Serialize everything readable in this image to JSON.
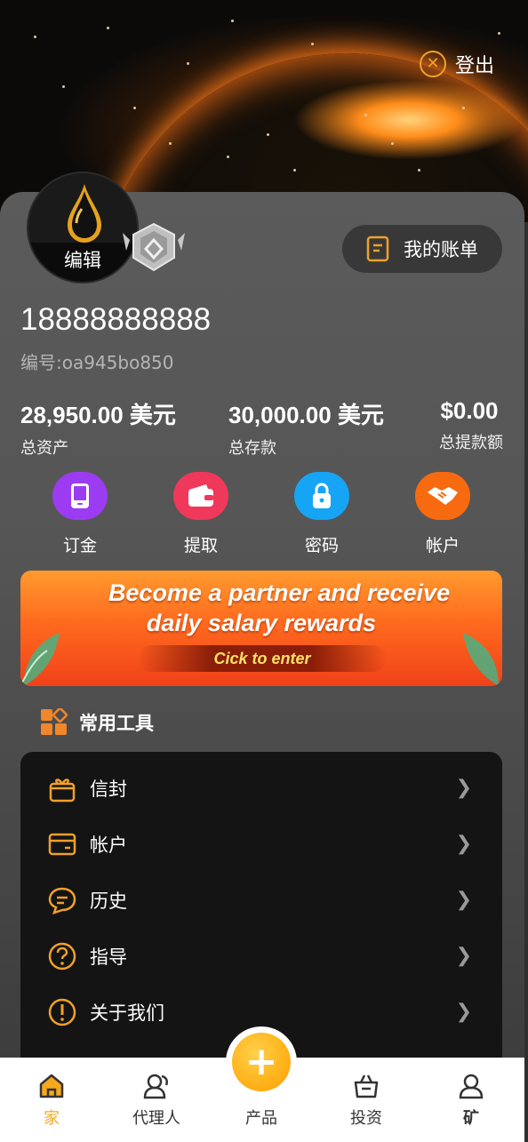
{
  "header": {
    "logout_label": "登出"
  },
  "profile": {
    "edit_label": "编辑",
    "bill_button": "我的账单",
    "phone": "18888888888",
    "uid": "编号:oa945bo850"
  },
  "stats": [
    {
      "value": "28,950.00 美元",
      "label": "总资产"
    },
    {
      "value": "30,000.00 美元",
      "label": "总存款"
    },
    {
      "value": "$0.00",
      "label": "总提款额"
    }
  ],
  "quick_actions": [
    {
      "label": "订金",
      "icon": "phone-icon",
      "color": "#9b3cf2"
    },
    {
      "label": "提取",
      "icon": "wallet-icon",
      "color": "#f0385a"
    },
    {
      "label": "密码",
      "icon": "lock-icon",
      "color": "#16a5f5"
    },
    {
      "label": "帐户",
      "icon": "handshake-icon",
      "color": "#f86a10"
    }
  ],
  "banner": {
    "line1": "Become a partner and receive",
    "line2": "daily salary rewards",
    "button": "Cick to enter"
  },
  "tools": {
    "title": "常用工具",
    "items": [
      {
        "label": "信封",
        "icon": "gift-icon"
      },
      {
        "label": "帐户",
        "icon": "card-icon"
      },
      {
        "label": "历史",
        "icon": "chat-icon"
      },
      {
        "label": "指导",
        "icon": "question-icon"
      },
      {
        "label": "关于我们",
        "icon": "info-icon"
      }
    ]
  },
  "bottom_nav": {
    "items": [
      {
        "label": "家",
        "icon": "home-icon",
        "active": true
      },
      {
        "label": "代理人",
        "icon": "agent-icon"
      },
      {
        "label": "产品",
        "icon": "plus-icon"
      },
      {
        "label": "投资",
        "icon": "bag-icon"
      },
      {
        "label": "矿",
        "icon": "user-icon"
      }
    ],
    "active_color": "#f5a81c"
  }
}
